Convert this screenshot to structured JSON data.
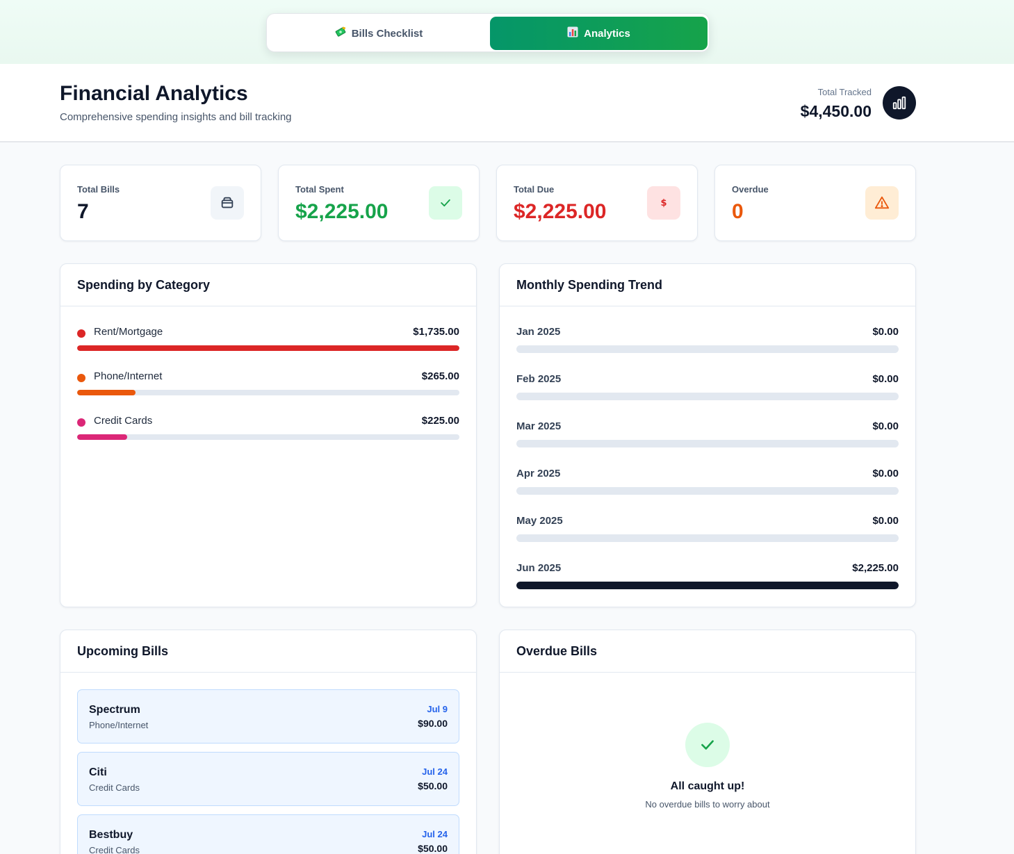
{
  "tabs": [
    {
      "label": "Bills Checklist",
      "icon": "money-icon",
      "active": false
    },
    {
      "label": "Analytics",
      "icon": "bar-chart-icon",
      "active": true
    }
  ],
  "header": {
    "title": "Financial Analytics",
    "subtitle": "Comprehensive spending insights and bill tracking",
    "tracked_label": "Total Tracked",
    "tracked_value": "$4,450.00"
  },
  "stats": [
    {
      "label": "Total Bills",
      "value": "7",
      "color": "#0f172a",
      "icon": "bills-icon",
      "icon_bg": "#f1f5f9"
    },
    {
      "label": "Total Spent",
      "value": "$2,225.00",
      "color": "#16a34a",
      "icon": "check-icon",
      "icon_bg": "#dcfce7"
    },
    {
      "label": "Total Due",
      "value": "$2,225.00",
      "color": "#dc2626",
      "icon": "dollar-icon",
      "icon_bg": "#fee2e2"
    },
    {
      "label": "Overdue",
      "value": "0",
      "color": "#ea580c",
      "icon": "warning-icon",
      "icon_bg": "#ffedd5"
    }
  ],
  "category_panel": {
    "title": "Spending by Category",
    "items": [
      {
        "name": "Rent/Mortgage",
        "amount": "$1,735.00",
        "color": "#dc2626",
        "fraction": 1.0
      },
      {
        "name": "Phone/Internet",
        "amount": "$265.00",
        "color": "#ea580c",
        "fraction": 0.153
      },
      {
        "name": "Credit Cards",
        "amount": "$225.00",
        "color": "#db2777",
        "fraction": 0.13
      }
    ]
  },
  "trend_panel": {
    "title": "Monthly Spending Trend",
    "months": [
      {
        "name": "Jan 2025",
        "amount": "$0.00",
        "fraction": 0
      },
      {
        "name": "Feb 2025",
        "amount": "$0.00",
        "fraction": 0
      },
      {
        "name": "Mar 2025",
        "amount": "$0.00",
        "fraction": 0
      },
      {
        "name": "Apr 2025",
        "amount": "$0.00",
        "fraction": 0
      },
      {
        "name": "May 2025",
        "amount": "$0.00",
        "fraction": 0
      },
      {
        "name": "Jun 2025",
        "amount": "$2,225.00",
        "fraction": 1.0
      }
    ]
  },
  "upcoming_panel": {
    "title": "Upcoming Bills",
    "bills": [
      {
        "name": "Spectrum",
        "category": "Phone/Internet",
        "date": "Jul 9",
        "amount": "$90.00"
      },
      {
        "name": "Citi",
        "category": "Credit Cards",
        "date": "Jul 24",
        "amount": "$50.00"
      },
      {
        "name": "Bestbuy",
        "category": "Credit Cards",
        "date": "Jul 24",
        "amount": "$50.00"
      }
    ]
  },
  "overdue_panel": {
    "title": "Overdue Bills",
    "empty_title": "All caught up!",
    "empty_subtitle": "No overdue bills to worry about"
  }
}
